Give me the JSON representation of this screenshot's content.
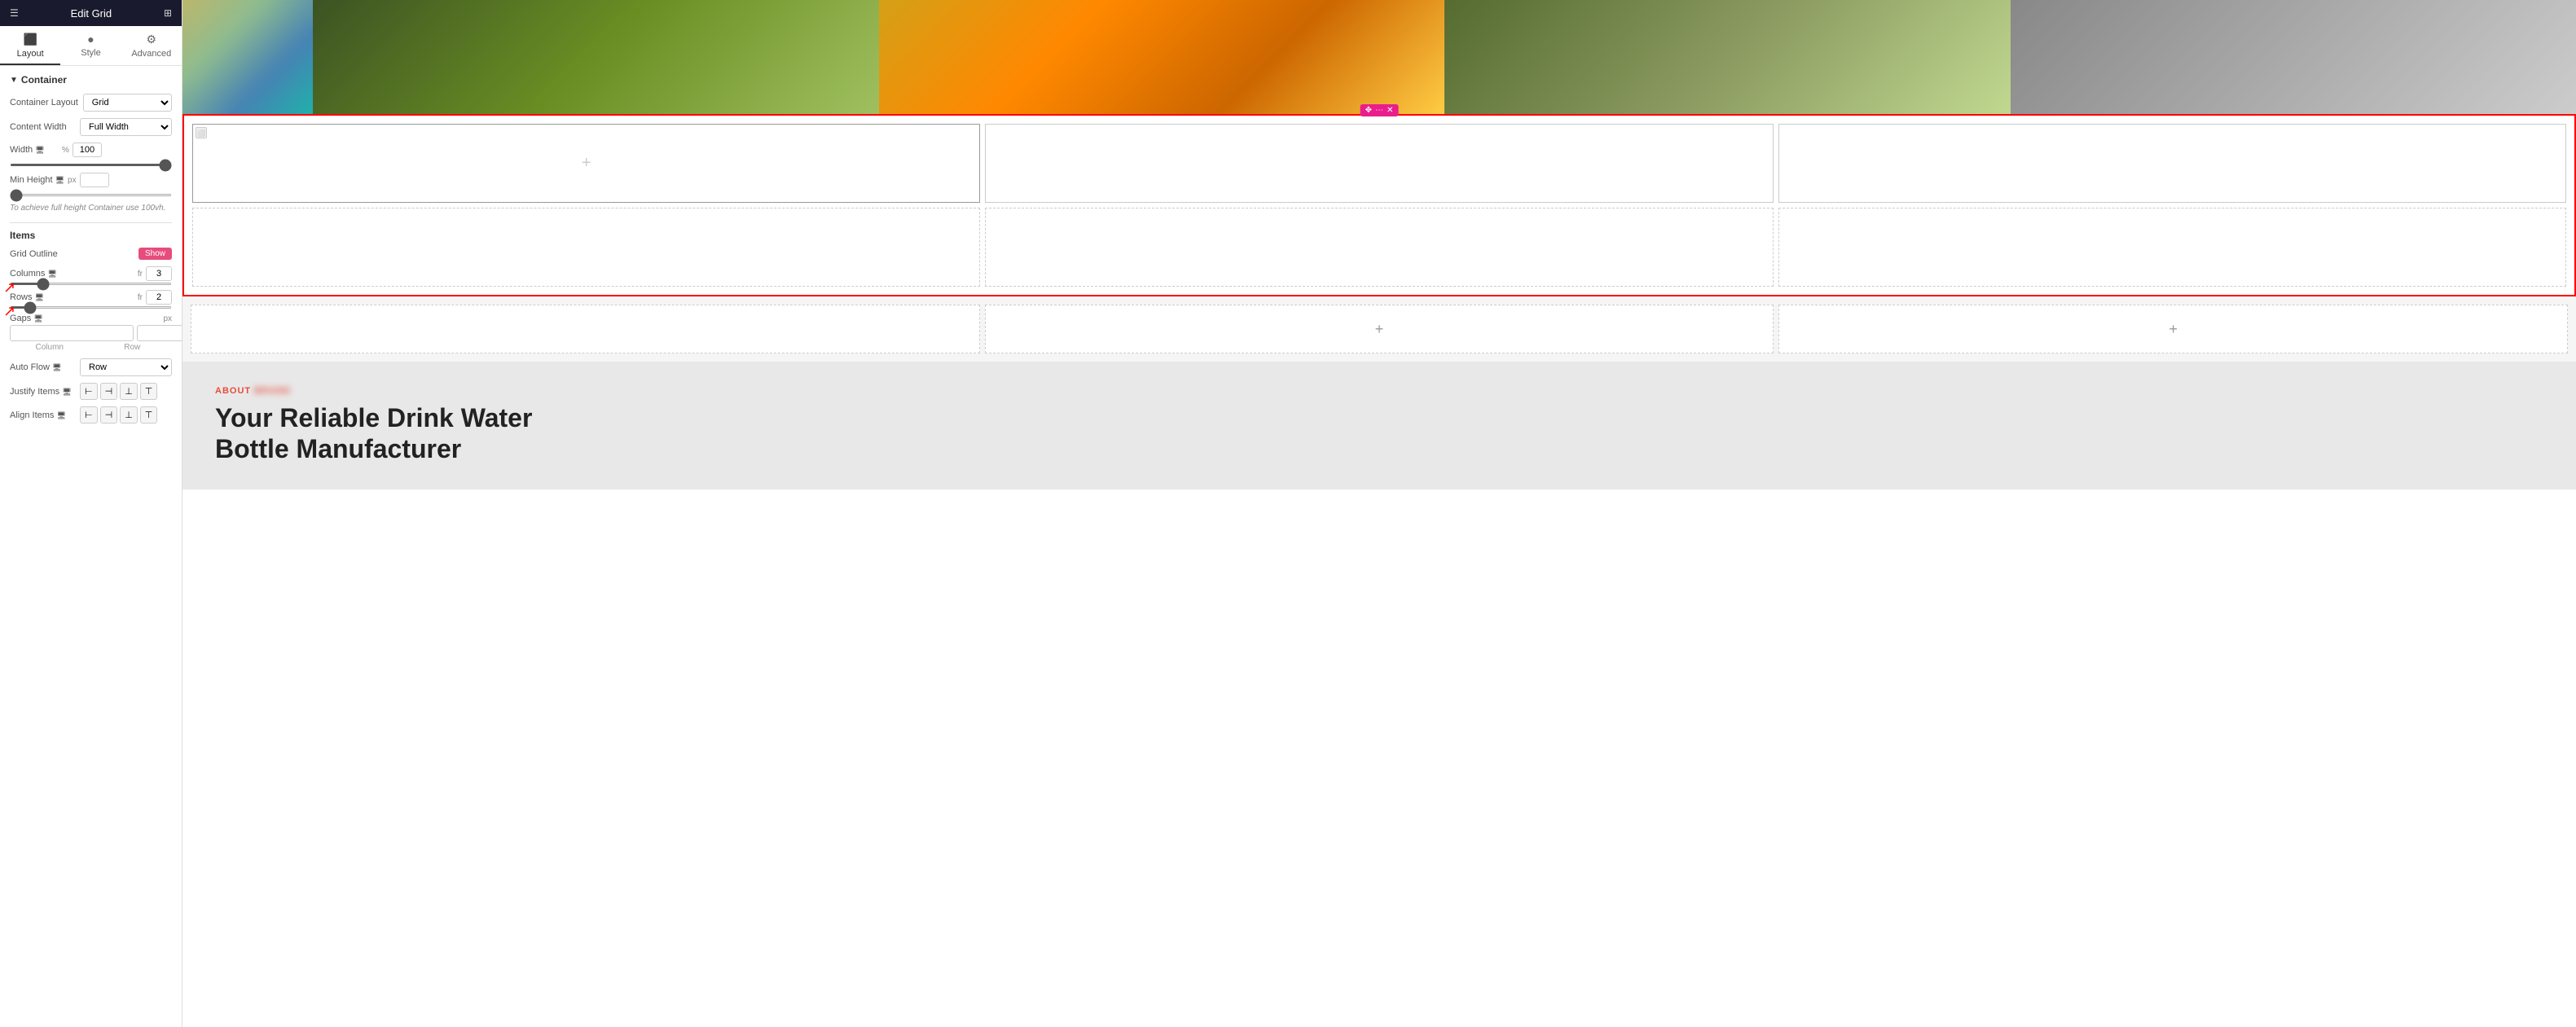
{
  "panel": {
    "header": {
      "title": "Edit Grid",
      "menu_icon": "☰",
      "grid_icon": "⊞"
    },
    "tabs": [
      {
        "label": "Layout",
        "icon": "⬛",
        "active": true
      },
      {
        "label": "Style",
        "icon": "●"
      },
      {
        "label": "Advanced",
        "icon": "⚙"
      }
    ],
    "container": {
      "section_label": "Container",
      "layout_label": "Container Layout",
      "layout_value": "Grid",
      "content_width_label": "Content Width",
      "content_width_value": "Full Width",
      "width_label": "Width",
      "width_unit": "%",
      "width_value": "100",
      "min_height_label": "Min Height",
      "min_height_unit": "px",
      "hint": "To achieve full height Container use 100vh."
    },
    "items": {
      "section_label": "Items",
      "grid_outline_label": "Grid Outline",
      "grid_outline_toggle": "Show",
      "columns_label": "Columns",
      "columns_unit": "fr",
      "columns_value": "3",
      "rows_label": "Rows",
      "rows_unit": "fr",
      "rows_value": "2",
      "gaps_label": "Gaps",
      "gaps_unit": "px",
      "gaps_column_placeholder": "",
      "gaps_row_placeholder": "",
      "gaps_column_label": "Column",
      "gaps_row_label": "Row",
      "auto_flow_label": "Auto Flow",
      "auto_flow_value": "Row",
      "justify_items_label": "Justify Items",
      "align_items_label": "Align Items"
    }
  },
  "grid_toolbar": {
    "move_icon": "✥",
    "dots_icon": "⋯",
    "close_icon": "✕"
  },
  "grid_cells": [
    {
      "id": 1,
      "has_corner": true,
      "has_plus": true
    },
    {
      "id": 2,
      "has_corner": false,
      "has_plus": false
    },
    {
      "id": 3,
      "has_corner": false,
      "has_plus": false
    },
    {
      "id": 4,
      "has_corner": false,
      "has_plus": false
    },
    {
      "id": 5,
      "has_corner": false,
      "has_plus": false
    },
    {
      "id": 6,
      "has_corner": false,
      "has_plus": false
    }
  ],
  "bottom_cells": [
    {
      "id": 1,
      "show_plus": false
    },
    {
      "id": 2,
      "show_plus": true
    },
    {
      "id": 3,
      "show_plus": true
    }
  ],
  "about_section": {
    "label": "ABOUT [BRAND]",
    "title_line1": "Your Reliable Drink Water",
    "title_line2": "Bottle Manufacturer"
  }
}
